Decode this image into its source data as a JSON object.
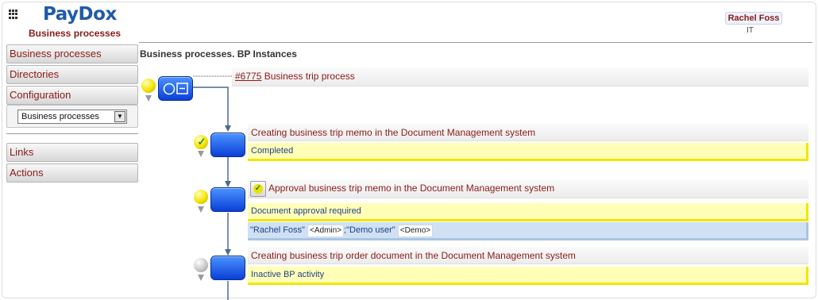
{
  "header": {
    "logo": "PayDox",
    "subtitle": "Business processes",
    "user_name": "Rachel Foss",
    "user_dept": "IT"
  },
  "sidebar": {
    "items": [
      {
        "label": "Business processes"
      },
      {
        "label": "Directories"
      },
      {
        "label": "Configuration"
      }
    ],
    "select_value": "Business processes",
    "bottom_items": [
      {
        "label": "Links"
      },
      {
        "label": "Actions"
      }
    ]
  },
  "main": {
    "title": "Business processes. BP Instances",
    "process": {
      "number": "#6775",
      "name": "Business trip process"
    },
    "steps": [
      {
        "title": "Creating business trip memo in the Document Management system",
        "status": "Completed",
        "state": "completed"
      },
      {
        "title": "Approval business trip memo in the Document Management system",
        "status": "Document approval required",
        "state": "active",
        "assignees_prefix": "\"Rachel Foss\"",
        "tag1": "<Admin>",
        "assignees_mid": ";\"Demo user\"",
        "tag2": "<Demo>"
      },
      {
        "title": "Creating business trip order document in the Document Management system",
        "status": "Inactive BP activity",
        "state": "inactive"
      }
    ]
  },
  "colors": {
    "brand": "#1f5aa8",
    "accent": "#8b1a1a",
    "status_bg": "#ffffb8",
    "status_border": "#f2e600",
    "assign_bg": "#cfe1f3",
    "node_blue": "#0a3fd6"
  },
  "icons": [
    "apps-grid-icon",
    "status-ball-icon",
    "checkmark-icon",
    "approve-icon",
    "dropdown-arrow-icon"
  ]
}
